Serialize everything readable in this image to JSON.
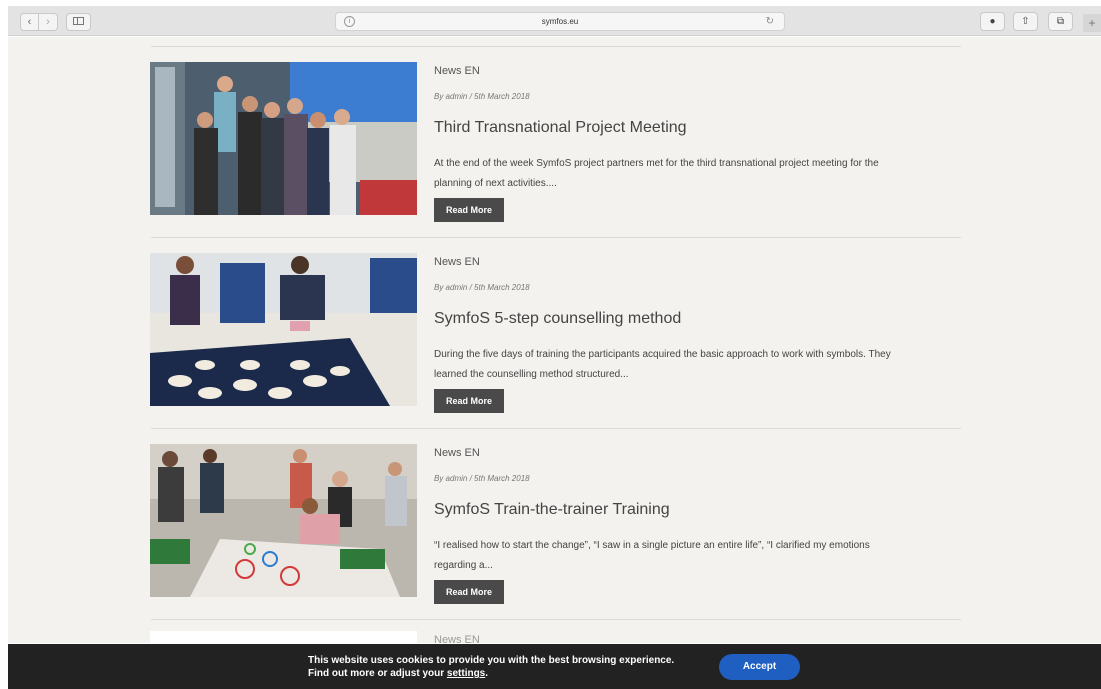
{
  "browser": {
    "url": "symfos.eu",
    "back_icon": "‹",
    "forward_icon": "›",
    "info_icon": "i",
    "reload_icon": "↻",
    "download_icon": "●",
    "share_icon": "⇧",
    "tabs_icon": "⧉",
    "new_tab_icon": "+"
  },
  "posts": [
    {
      "category": "News EN",
      "byline": "By admin / 5th March 2018",
      "title": "Third Transnational Project Meeting",
      "excerpt": "At the end of the week SymfoS project partners met for the third transnational project meeting for the planning of next activities....",
      "button": "Read More"
    },
    {
      "category": "News EN",
      "byline": "By admin / 5th March 2018",
      "title": "SymfoS 5-step counselling method",
      "excerpt": "During the five days of training the participants acquired the basic approach to work with symbols. They learned the counselling method structured...",
      "button": "Read More"
    },
    {
      "category": "News EN",
      "byline": "By admin / 5th March 2018",
      "title": "SymfoS Train-the-trainer Training",
      "excerpt": "“I realised how to start the change”, “I saw in a single picture an entire life”, “I clarified my emotions regarding a...",
      "button": "Read More"
    }
  ],
  "next_post": {
    "category": "News EN"
  },
  "cookie": {
    "line1": "This website uses cookies to provide you with the best browsing experience.",
    "line2_prefix": "Find out more or adjust your ",
    "settings_link": "settings",
    "line2_suffix": ".",
    "accept": "Accept"
  },
  "colors": {
    "accent_button": "#1f5fc1",
    "read_more_bg": "#4a4a4a",
    "banner_bg": "#222222",
    "page_bg": "#f3f2ee"
  }
}
